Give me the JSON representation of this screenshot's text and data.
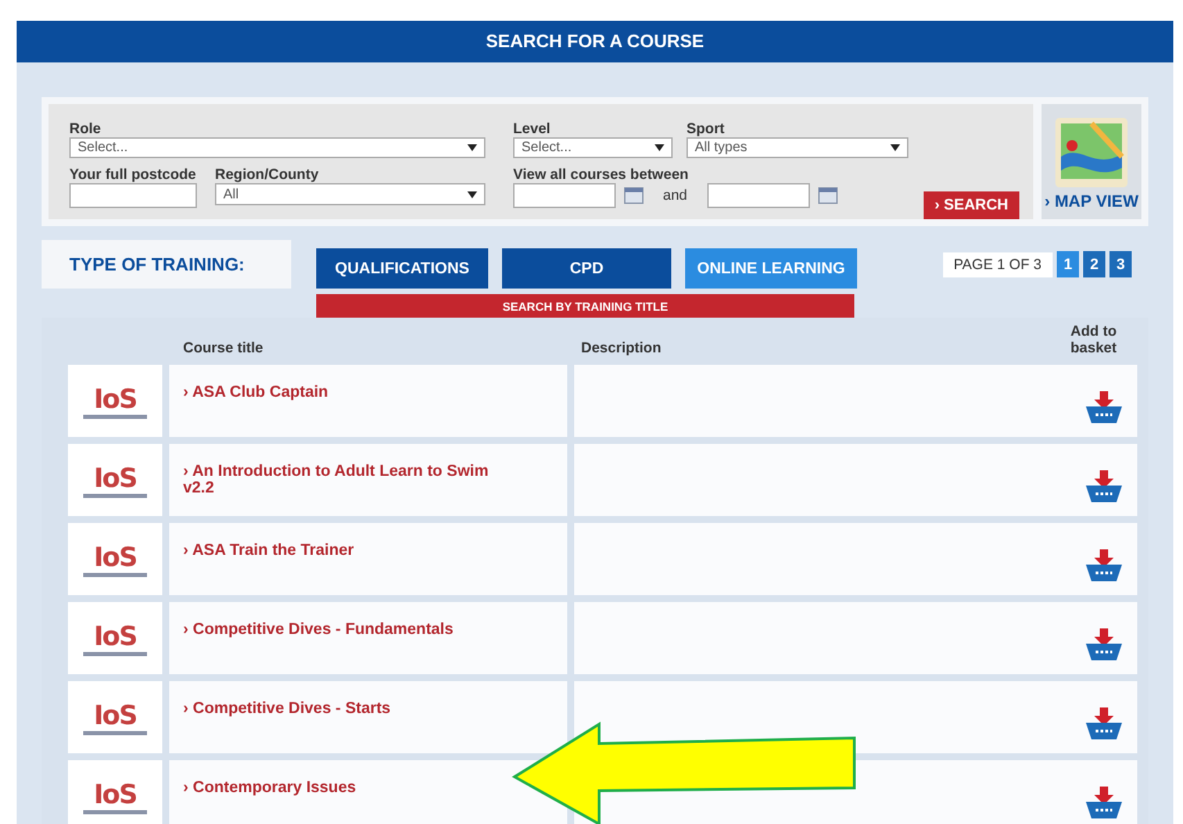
{
  "header": {
    "title": "SEARCH FOR A COURSE"
  },
  "filters": {
    "role": {
      "label": "Role",
      "value": "Select..."
    },
    "level": {
      "label": "Level",
      "value": "Select..."
    },
    "sport": {
      "label": "Sport",
      "value": "All types"
    },
    "postcode": {
      "label": "Your full postcode"
    },
    "region": {
      "label": "Region/County",
      "value": "All"
    },
    "dates": {
      "label": "View all courses between",
      "joiner": "and"
    },
    "search_button": "› SEARCH"
  },
  "map_view": {
    "label": "› MAP VIEW"
  },
  "training": {
    "label": "TYPE OF TRAINING:",
    "tabs": [
      {
        "label": "QUALIFICATIONS",
        "selected": false
      },
      {
        "label": "CPD",
        "selected": false
      },
      {
        "label": "ONLINE LEARNING",
        "selected": true
      }
    ],
    "title_search": "SEARCH BY TRAINING TITLE"
  },
  "pagination": {
    "label": "PAGE 1 OF 3",
    "pages": [
      {
        "label": "1",
        "selected": true
      },
      {
        "label": "2",
        "selected": false
      },
      {
        "label": "3",
        "selected": false
      }
    ]
  },
  "table": {
    "columns": [
      "Course title",
      "Description",
      "Add to basket"
    ],
    "rows": [
      {
        "logo": "IoS",
        "title": "› ASA Club Captain"
      },
      {
        "logo": "IoS",
        "title": "› An Introduction to Adult Learn to Swim v2.2"
      },
      {
        "logo": "IoS",
        "title": "› ASA Train the Trainer"
      },
      {
        "logo": "IoS",
        "title": "› Competitive Dives - Fundamentals"
      },
      {
        "logo": "IoS",
        "title": "› Competitive Dives - Starts"
      },
      {
        "logo": "IoS",
        "title": "› Contemporary Issues"
      }
    ]
  },
  "annotation": {
    "kind": "arrow"
  }
}
